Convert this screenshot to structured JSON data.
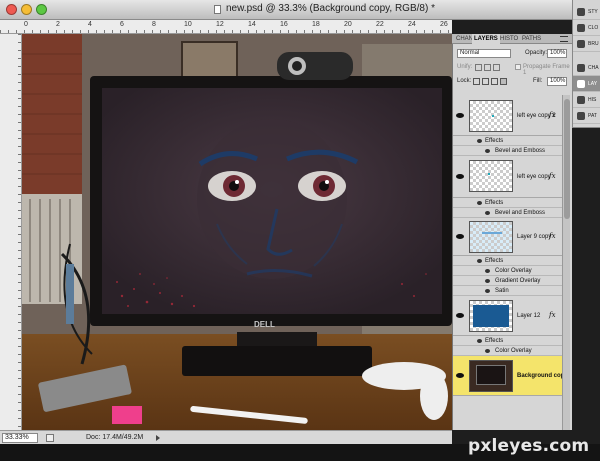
{
  "window": {
    "title": "new.psd @ 33.3% (Background copy, RGB/8) *"
  },
  "rulers": {
    "top_numbers": [
      "0",
      "2",
      "4",
      "6",
      "8",
      "10",
      "12",
      "14",
      "16",
      "18",
      "20",
      "22",
      "24",
      "26"
    ]
  },
  "status": {
    "zoom": "33.33%",
    "doc": "Doc: 17.4M/49.2M"
  },
  "panel": {
    "tabs": [
      "CHAN",
      "LAYERS",
      "HISTO",
      "PATHS"
    ],
    "active_tab": "LAYERS",
    "blend_mode": "Normal",
    "opacity_label": "Opacity:",
    "opacity_value": "100%",
    "unify_label": "Unify:",
    "propagate_label": "Propagate Frame 1",
    "lock_label": "Lock:",
    "fill_label": "Fill:",
    "fill_value": "100%",
    "effects_label": "Effects",
    "fx_label": "fx",
    "layers": [
      {
        "name": "left eye copy 2",
        "effects": [
          "Bevel and Emboss"
        ]
      },
      {
        "name": "left eye copy",
        "effects": [
          "Bevel and Emboss"
        ]
      },
      {
        "name": "Layer 9 copy",
        "effects": [
          "Color Overlay",
          "Gradient Overlay",
          "Satin"
        ]
      },
      {
        "name": "Layer 12",
        "effects": [
          "Color Overlay"
        ]
      },
      {
        "name": "Background copy",
        "effects": []
      }
    ],
    "selected_layer": "Background copy"
  },
  "dock": {
    "items": [
      "STY",
      "CLO",
      "BRU",
      "CHA",
      "LAY",
      "HIS",
      "PAT"
    ],
    "selected": "LAY"
  },
  "watermark": "pxleyes.com",
  "colors": {
    "selected_layer": "#f4e46b",
    "panel_bg": "#d6d6d6",
    "layer12_fill": "#1a5a93"
  }
}
